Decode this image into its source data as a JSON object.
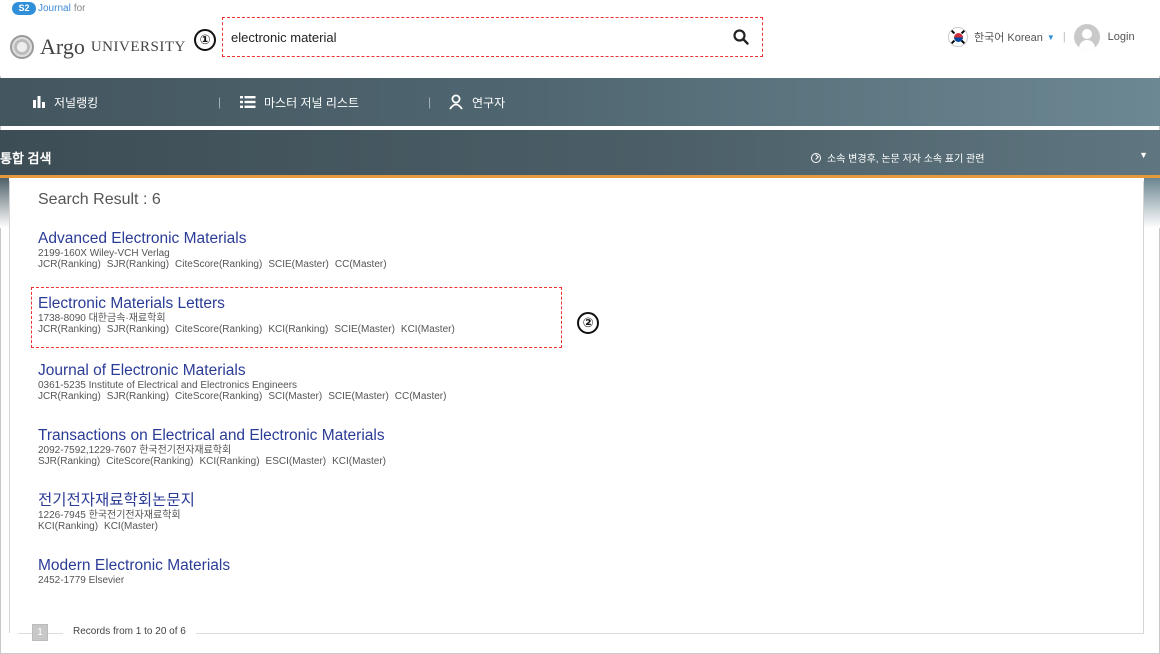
{
  "logo": {
    "badge": "S2",
    "top_label": "Journal",
    "for_label": "for",
    "name": "Argo",
    "university": "UNIVERSITY"
  },
  "markers": {
    "one": "①",
    "two": "②"
  },
  "search": {
    "value": "electronic material"
  },
  "header": {
    "language": "한국어 Korean",
    "login": "Login"
  },
  "nav": {
    "items": [
      {
        "label": "저널랭킹",
        "icon": "bar-chart-icon"
      },
      {
        "label": "마스터 저널 리스트",
        "icon": "list-icon"
      },
      {
        "label": "연구자",
        "icon": "person-icon"
      }
    ],
    "separator": "|"
  },
  "section": {
    "title": "통합 검색",
    "notice": "소속 변경후, 논문 저자 소속 표기 관련"
  },
  "results": {
    "heading": "Search Result : 6",
    "items": [
      {
        "title": "Advanced Electronic Materials",
        "meta": "2199-160X Wiley-VCH Verlag",
        "links": [
          "JCR(Ranking)",
          "SJR(Ranking)",
          "CiteScore(Ranking)",
          "SCIE(Master)",
          "CC(Master)"
        ]
      },
      {
        "title": "Electronic Materials Letters",
        "meta": "1738-8090 대한금속·재료학회",
        "links": [
          "JCR(Ranking)",
          "SJR(Ranking)",
          "CiteScore(Ranking)",
          "KCI(Ranking)",
          "SCIE(Master)",
          "KCI(Master)"
        ]
      },
      {
        "title": "Journal of Electronic Materials",
        "meta": "0361-5235 Institute of Electrical and Electronics Engineers",
        "links": [
          "JCR(Ranking)",
          "SJR(Ranking)",
          "CiteScore(Ranking)",
          "SCI(Master)",
          "SCIE(Master)",
          "CC(Master)"
        ]
      },
      {
        "title": "Transactions on Electrical and Electronic Materials",
        "meta": "2092-7592,1229-7607 한국전기전자재료학회",
        "links": [
          "SJR(Ranking)",
          "CiteScore(Ranking)",
          "KCI(Ranking)",
          "ESCI(Master)",
          "KCI(Master)"
        ]
      },
      {
        "title": "전기전자재료학회논문지",
        "meta": "1226-7945 한국전기전자재료학회",
        "links": [
          "KCI(Ranking)",
          "KCI(Master)"
        ]
      },
      {
        "title": "Modern Electronic Materials",
        "meta": "2452-1779 Elsevier",
        "links": []
      }
    ]
  },
  "pager": {
    "text": "Records from 1 to 20 of 6"
  },
  "colors": {
    "accent_orange": "#e29a3a",
    "link_blue": "#2b3c97",
    "nav_bg": "#4f6670",
    "annotation_red": "#e33333"
  }
}
